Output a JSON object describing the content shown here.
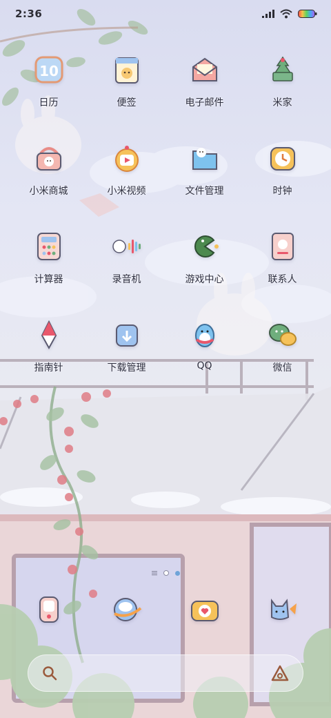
{
  "status_bar": {
    "time": "2:36",
    "icons": [
      "signal-icon",
      "wifi-icon",
      "battery-icon"
    ]
  },
  "apps": [
    {
      "label": "日历",
      "icon": "calendar-icon",
      "icon_text": "10"
    },
    {
      "label": "便签",
      "icon": "notes-icon"
    },
    {
      "label": "电子邮件",
      "icon": "email-icon"
    },
    {
      "label": "米家",
      "icon": "mihome-icon"
    },
    {
      "label": "小米商城",
      "icon": "mall-basket-icon"
    },
    {
      "label": "小米视频",
      "icon": "video-icon"
    },
    {
      "label": "文件管理",
      "icon": "folder-icon"
    },
    {
      "label": "时钟",
      "icon": "clock-icon"
    },
    {
      "label": "计算器",
      "icon": "calculator-icon"
    },
    {
      "label": "录音机",
      "icon": "recorder-icon"
    },
    {
      "label": "游戏中心",
      "icon": "game-center-icon"
    },
    {
      "label": "联系人",
      "icon": "contacts-icon"
    },
    {
      "label": "指南针",
      "icon": "compass-icon"
    },
    {
      "label": "下载管理",
      "icon": "download-icon"
    },
    {
      "label": "QQ",
      "icon": "qq-icon"
    },
    {
      "label": "微信",
      "icon": "wechat-icon"
    }
  ],
  "dock": [
    {
      "icon": "phone-icon"
    },
    {
      "icon": "messages-icon"
    },
    {
      "icon": "camera-icon"
    },
    {
      "icon": "browser-icon"
    }
  ],
  "page_indicator": {
    "pages": 2,
    "active": 1
  },
  "search_bar": {
    "left_icon": "search-icon",
    "right_icon": "xiaoai-icon"
  },
  "colors": {
    "label": "#2f3040",
    "accent_blue": "#6fa4d8"
  }
}
